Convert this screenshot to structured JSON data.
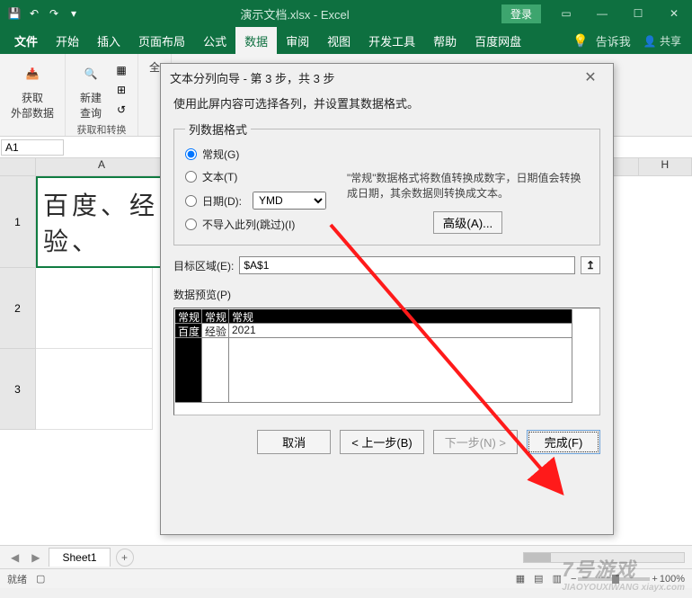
{
  "titlebar": {
    "title": "演示文档.xlsx - Excel",
    "login": "登录"
  },
  "tabs": {
    "file": "文件",
    "home": "开始",
    "insert": "插入",
    "layout": "页面布局",
    "formulas": "公式",
    "data": "数据",
    "review": "审阅",
    "view": "视图",
    "dev": "开发工具",
    "help": "帮助",
    "baidu": "百度网盘",
    "tellme": "告诉我",
    "share": "共享"
  },
  "ribbon": {
    "group1": {
      "btn": "获取\n外部数据",
      "label": ""
    },
    "group2": {
      "btn": "新建\n查询",
      "label": "获取和转换"
    },
    "group3": {
      "btn": "全"
    }
  },
  "namebox": "A1",
  "cols": {
    "A": "A",
    "H": "H"
  },
  "rows": {
    "r1": "1",
    "r2": "2",
    "r3": "3"
  },
  "cellA1": "百度、经验、",
  "sheettab": {
    "name": "Sheet1"
  },
  "status": {
    "ready": "就绪",
    "zoom": "100%"
  },
  "dialog": {
    "title": "文本分列向导 - 第 3 步，共 3 步",
    "instruction": "使用此屏内容可选择各列，并设置其数据格式。",
    "fieldset_legend": "列数据格式",
    "radio_general": "常规(G)",
    "radio_text": "文本(T)",
    "radio_date": "日期(D):",
    "date_option": "YMD",
    "radio_skip": "不导入此列(跳过)(I)",
    "description": "\"常规\"数据格式将数值转换成数字，日期值会转换成日期，其余数据则转换成文本。",
    "advanced": "高级(A)...",
    "dest_label": "目标区域(E):",
    "dest_value": "$A$1",
    "preview_label": "数据预览(P)",
    "preview_headers": [
      "常规",
      "常规",
      "常规"
    ],
    "preview_row": [
      "百度",
      "经验",
      "2021"
    ],
    "btn_cancel": "取消",
    "btn_back": "< 上一步(B)",
    "btn_next": "下一步(N) >",
    "btn_finish": "完成(F)"
  },
  "watermark": {
    "main": "7号游戏",
    "sub": "JIAOYOUXIWANG  xiayx.com"
  }
}
